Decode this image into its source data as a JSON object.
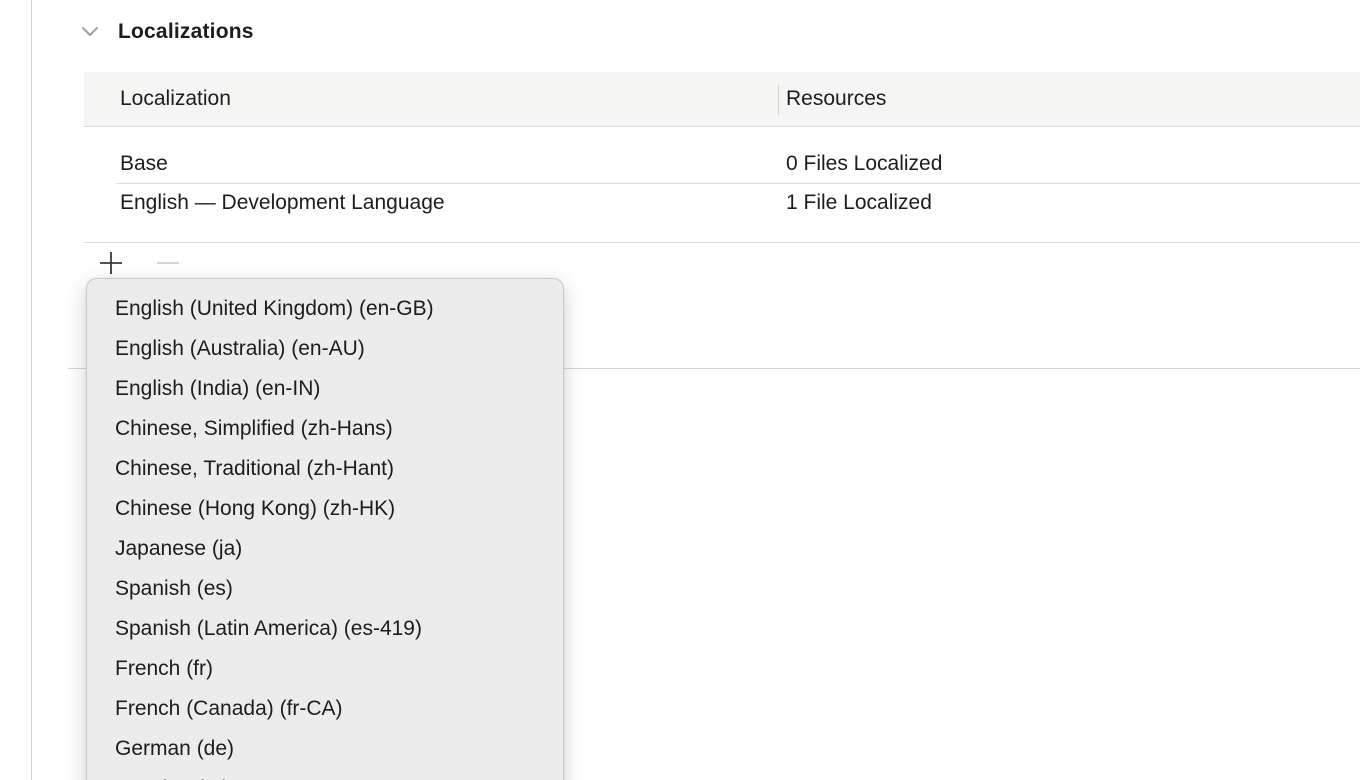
{
  "section": {
    "title": "Localizations",
    "disclosure_icon": "chevron-down-icon"
  },
  "table": {
    "headers": {
      "localization": "Localization",
      "resources": "Resources"
    },
    "rows": [
      {
        "localization": "Base",
        "resources": "0 Files Localized"
      },
      {
        "localization": "English — Development Language",
        "resources": "1 File Localized"
      }
    ]
  },
  "controls": {
    "add_icon": "plus-icon",
    "remove_icon": "minus-icon"
  },
  "language_menu": {
    "items": [
      "English (United Kingdom) (en-GB)",
      "English (Australia) (en-AU)",
      "English (India) (en-IN)",
      "Chinese, Simplified (zh-Hans)",
      "Chinese, Traditional (zh-Hant)",
      "Chinese (Hong Kong) (zh-HK)",
      "Japanese (ja)",
      "Spanish (es)",
      "Spanish (Latin America) (es-419)",
      "French (fr)",
      "French (Canada) (fr-CA)",
      "German (de)",
      "Russian (ru)"
    ]
  },
  "colors": {
    "header_background": "#f5f5f4",
    "menu_background": "#ececec",
    "text": "#1d1d1f",
    "separator": "#d9d9d9"
  }
}
